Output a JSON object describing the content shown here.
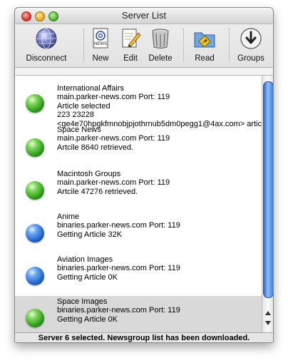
{
  "window": {
    "title": "Server List"
  },
  "toolbar": {
    "disconnect": "Disconnect",
    "new": "New",
    "edit": "Edit",
    "delete": "Delete",
    "read": "Read",
    "groups": "Groups",
    "news_icon_text": "NEWS"
  },
  "servers": [
    {
      "name": "International Affairs",
      "host": "main.parker-news.com Port: 119",
      "status": "Article selected",
      "extra1": "223 23228",
      "extra2": "<ge4e70hpgkfmnobjpjothrnub5dm0pegg1@4ax.com> artic",
      "globe": "green"
    },
    {
      "name": "Space News",
      "host": "main.parker-news.com Port: 119",
      "status": "Artcile 8640 retrieved.",
      "globe": "green"
    },
    {
      "name": "Macintosh Groups",
      "host": "main.parker-news.com Port: 119",
      "status": "Artcile 47276 retrieved.",
      "globe": "green"
    },
    {
      "name": "Anime",
      "host": "binaries.parker-news.com Port: 119",
      "status": "Getting Article 32K",
      "globe": "blue"
    },
    {
      "name": "Aviation Images",
      "host": "binaries.parker-news.com Port: 119",
      "status": "Getting Article 0K",
      "globe": "blue"
    },
    {
      "name": "Space Images",
      "host": "binaries.parker-news.com Port: 119",
      "status": "Getting Article 0K",
      "globe": "green"
    }
  ],
  "selected_index": 5,
  "status_bar": {
    "text": "Server 6 selected. Newsgroup list has been downloaded."
  },
  "colors": {
    "selection": "#d9d9d9",
    "scroll_thumb": "#3d7ddf",
    "globe_green": "#2f9a1b",
    "globe_blue": "#2062c8"
  }
}
